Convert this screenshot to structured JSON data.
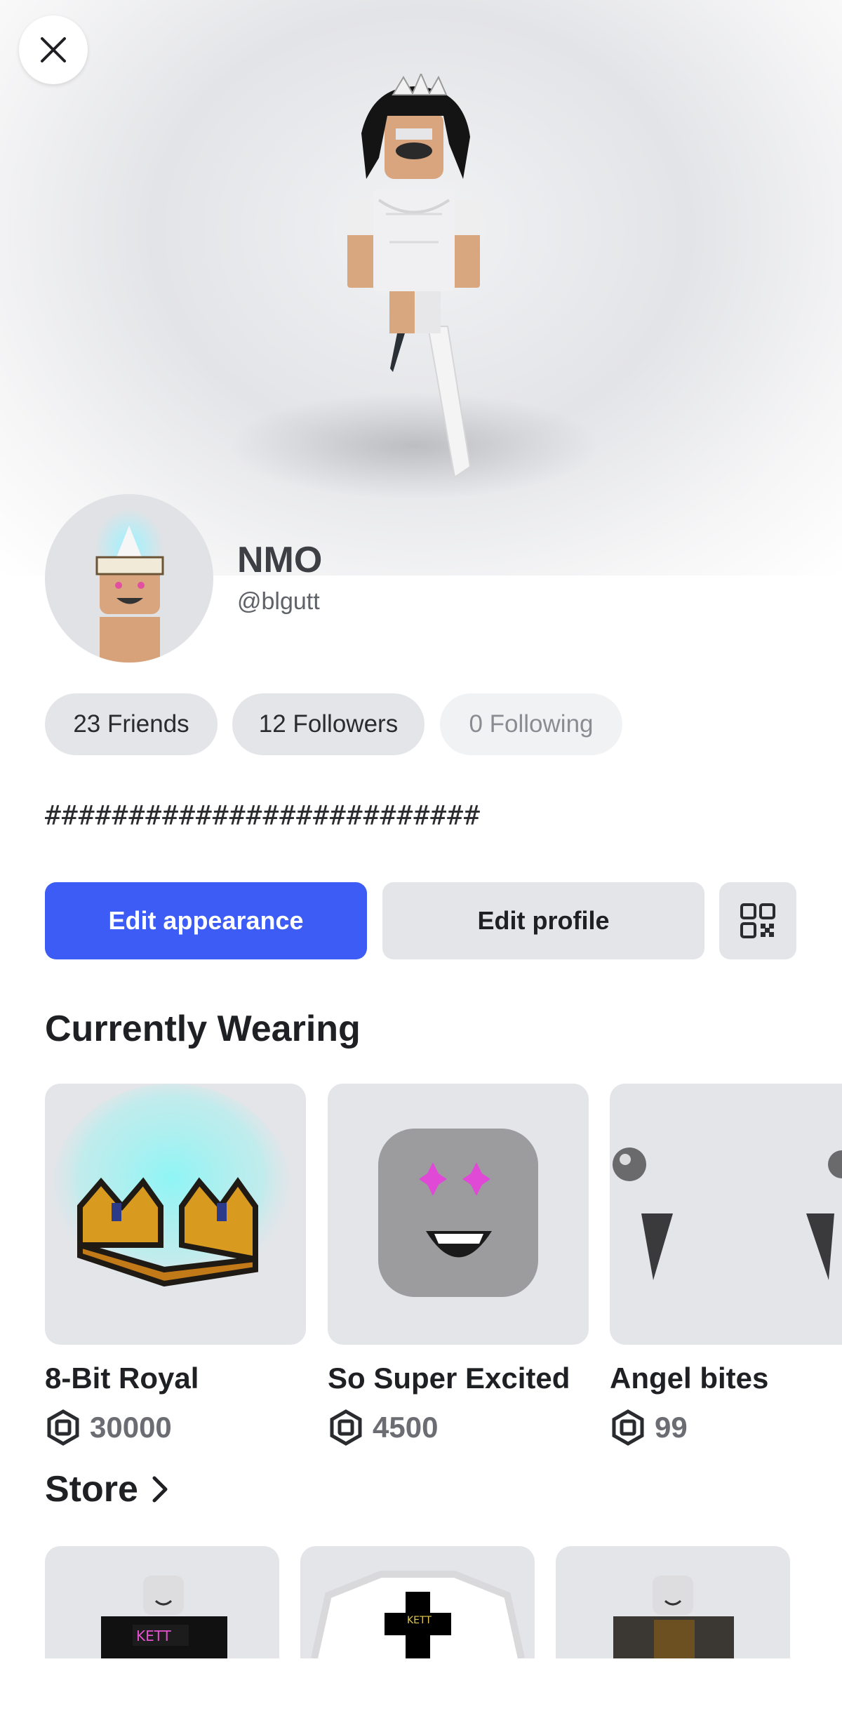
{
  "profile": {
    "display_name": "NMO",
    "username": "@blgutt",
    "bio": "##########################"
  },
  "stats": {
    "friends": "23 Friends",
    "followers": "12 Followers",
    "following": "0 Following"
  },
  "actions": {
    "edit_appearance": "Edit appearance",
    "edit_profile": "Edit profile",
    "qr_icon": "qr-code-icon"
  },
  "wearing": {
    "title": "Currently Wearing",
    "items": [
      {
        "name": "8-Bit Royal",
        "price": "30000"
      },
      {
        "name": "So Super Excited",
        "price": "4500"
      },
      {
        "name": "Angel bites",
        "price": "99"
      }
    ]
  },
  "store": {
    "title": "Store"
  },
  "colors": {
    "primary": "#3c5cf5",
    "pill": "#e4e5e9",
    "text": "#1f2023"
  }
}
